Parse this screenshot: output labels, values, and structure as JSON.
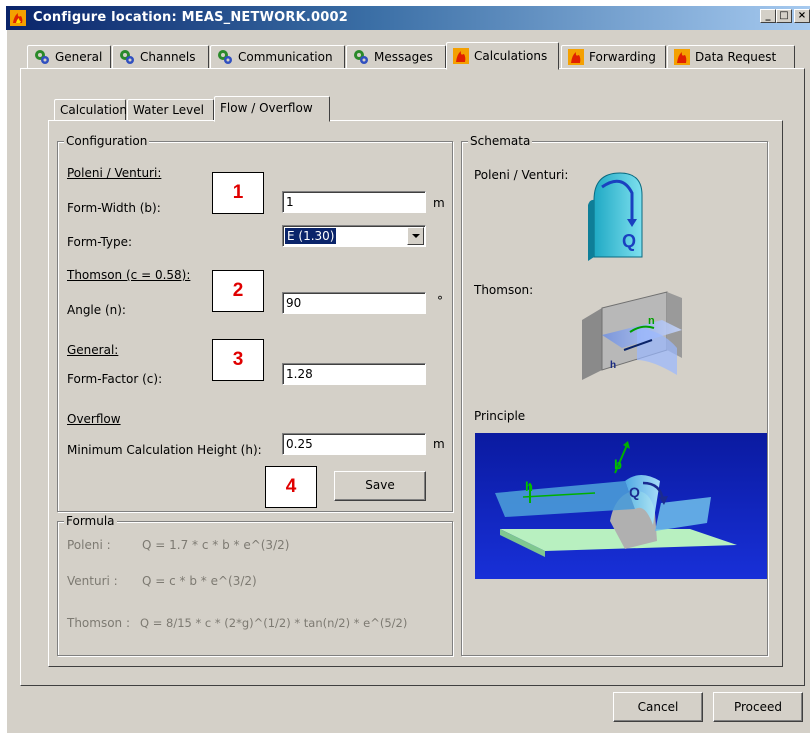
{
  "window": {
    "title": "Configure location: MEAS_NETWORK.0002",
    "minimize": "_",
    "maximize": "□",
    "close": "×"
  },
  "tabs": [
    {
      "label": "General",
      "icon": "gear-network-icon"
    },
    {
      "label": "Channels",
      "icon": "gear-network-icon"
    },
    {
      "label": "Communication",
      "icon": "gear-network-icon"
    },
    {
      "label": "Messages",
      "icon": "gear-network-icon"
    },
    {
      "label": "Calculations",
      "icon": "fire-icon",
      "active": true
    },
    {
      "label": "Forwarding",
      "icon": "fire-icon"
    },
    {
      "label": "Data Request",
      "icon": "fire-icon"
    }
  ],
  "subtabs": [
    {
      "label": "Calculation"
    },
    {
      "label": "Water Level"
    },
    {
      "label": "Flow / Overflow",
      "active": true
    }
  ],
  "configuration": {
    "title": "Configuration",
    "poleni_heading": "Poleni / Venturi:",
    "form_width_label": "Form-Width (b):",
    "form_width_value": "1",
    "form_width_unit": "m",
    "form_type_label": "Form-Type:",
    "form_type_value": "E (1.30)",
    "thomson_heading": "Thomson (c = 0.58):",
    "angle_label": "Angle (n):",
    "angle_value": "90",
    "angle_unit": "°",
    "general_heading": "General:",
    "form_factor_label": "Form-Factor (c):",
    "form_factor_value": "1.28",
    "overflow_heading": "Overflow",
    "min_height_label": "Minimum Calculation Height (h):",
    "min_height_value": "0.25",
    "min_height_unit": "m",
    "save_label": "Save"
  },
  "markers": [
    "1",
    "2",
    "3",
    "4"
  ],
  "formula": {
    "title": "Formula",
    "poleni_label": "Poleni :",
    "poleni_formula": "Q = 1.7 * c * b * e^(3/2)",
    "venturi_label": "Venturi :",
    "venturi_formula": "Q = c * b * e^(3/2)",
    "thomson_label": "Thomson :",
    "thomson_formula": "Q = 8/15 * c * (2*g)^(1/2) * tan(n/2) * e^(5/2)"
  },
  "schemata": {
    "title": "Schemata",
    "poleni_label": "Poleni / Venturi:",
    "thomson_label": "Thomson:",
    "principle_label": "Principle",
    "poleni_q": "Q",
    "principle_q": "Q",
    "principle_b": "b",
    "principle_h": "h",
    "thomson_h": "h",
    "thomson_n": "n"
  },
  "footer": {
    "cancel_label": "Cancel",
    "proceed_label": "Proceed"
  }
}
